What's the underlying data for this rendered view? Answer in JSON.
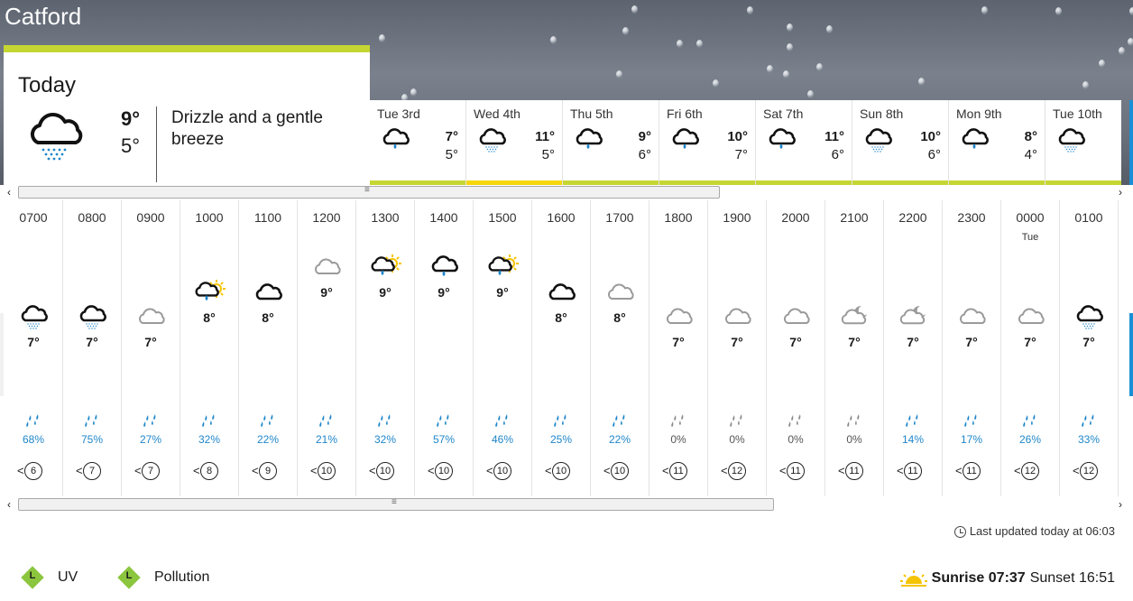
{
  "location": "Catford",
  "today": {
    "label": "Today",
    "high": "9°",
    "low": "5°",
    "description": "Drizzle and a gentle breeze",
    "icon": "cloud-drizzle-icon"
  },
  "days": [
    {
      "dow": "Tue",
      "date": "3rd",
      "high": "7°",
      "low": "5°",
      "icon": "cloud-rain-icon",
      "bar_color": "#c5d633"
    },
    {
      "dow": "Wed",
      "date": "4th",
      "high": "11°",
      "low": "5°",
      "icon": "cloud-drizzle-icon",
      "bar_color": "#f5d70c"
    },
    {
      "dow": "Thu",
      "date": "5th",
      "high": "9°",
      "low": "6°",
      "icon": "cloud-rain-icon",
      "bar_color": "#c5d633"
    },
    {
      "dow": "Fri",
      "date": "6th",
      "high": "10°",
      "low": "7°",
      "icon": "cloud-rain-icon",
      "bar_color": "#c5d633"
    },
    {
      "dow": "Sat",
      "date": "7th",
      "high": "11°",
      "low": "6°",
      "icon": "cloud-rain-icon",
      "bar_color": "#c5d633"
    },
    {
      "dow": "Sun",
      "date": "8th",
      "high": "10°",
      "low": "6°",
      "icon": "cloud-drizzle-icon",
      "bar_color": "#c5d633"
    },
    {
      "dow": "Mon",
      "date": "9th",
      "high": "8°",
      "low": "4°",
      "icon": "cloud-rain-icon",
      "bar_color": "#c5d633"
    },
    {
      "dow": "Tue",
      "date": "10th",
      "high": "",
      "low": "",
      "icon": "cloud-drizzle-icon",
      "bar_color": "#c5d633"
    }
  ],
  "hours": [
    {
      "time": "0700",
      "sub": "",
      "temp": "7°",
      "icon": "cloud-drizzle-icon",
      "prob": "68%",
      "wind": "6"
    },
    {
      "time": "0800",
      "sub": "",
      "temp": "7°",
      "icon": "cloud-drizzle-icon",
      "prob": "75%",
      "wind": "7"
    },
    {
      "time": "0900",
      "sub": "",
      "temp": "7°",
      "icon": "grey-cloud-icon",
      "prob": "27%",
      "wind": "7"
    },
    {
      "time": "1000",
      "sub": "",
      "temp": "8°",
      "icon": "sun-cloud-rain-icon",
      "prob": "32%",
      "wind": "8"
    },
    {
      "time": "1100",
      "sub": "",
      "temp": "8°",
      "icon": "black-cloud-icon",
      "prob": "22%",
      "wind": "9"
    },
    {
      "time": "1200",
      "sub": "",
      "temp": "9°",
      "icon": "grey-cloud-icon",
      "prob": "21%",
      "wind": "10"
    },
    {
      "time": "1300",
      "sub": "",
      "temp": "9°",
      "icon": "sun-cloud-rain-icon",
      "prob": "32%",
      "wind": "10"
    },
    {
      "time": "1400",
      "sub": "",
      "temp": "9°",
      "icon": "cloud-rain-icon",
      "prob": "57%",
      "wind": "10"
    },
    {
      "time": "1500",
      "sub": "",
      "temp": "9°",
      "icon": "sun-cloud-rain-icon",
      "prob": "46%",
      "wind": "10"
    },
    {
      "time": "1600",
      "sub": "",
      "temp": "8°",
      "icon": "black-cloud-icon",
      "prob": "25%",
      "wind": "10"
    },
    {
      "time": "1700",
      "sub": "",
      "temp": "8°",
      "icon": "grey-cloud-icon",
      "prob": "22%",
      "wind": "10"
    },
    {
      "time": "1800",
      "sub": "",
      "temp": "7°",
      "icon": "grey-cloud-icon",
      "prob": "0%",
      "wind": "11"
    },
    {
      "time": "1900",
      "sub": "",
      "temp": "7°",
      "icon": "grey-cloud-icon",
      "prob": "0%",
      "wind": "12"
    },
    {
      "time": "2000",
      "sub": "",
      "temp": "7°",
      "icon": "grey-cloud-icon",
      "prob": "0%",
      "wind": "11"
    },
    {
      "time": "2100",
      "sub": "",
      "temp": "7°",
      "icon": "moon-cloud-icon",
      "prob": "0%",
      "wind": "11"
    },
    {
      "time": "2200",
      "sub": "",
      "temp": "7°",
      "icon": "moon-cloud-icon",
      "prob": "14%",
      "wind": "11"
    },
    {
      "time": "2300",
      "sub": "",
      "temp": "7°",
      "icon": "grey-cloud-icon",
      "prob": "17%",
      "wind": "11"
    },
    {
      "time": "0000",
      "sub": "Tue",
      "temp": "7°",
      "icon": "grey-cloud-icon",
      "prob": "26%",
      "wind": "12"
    },
    {
      "time": "0100",
      "sub": "",
      "temp": "7°",
      "icon": "cloud-drizzle-icon",
      "prob": "33%",
      "wind": "12"
    }
  ],
  "updated": "Last updated today at 06:03",
  "legend": [
    {
      "badge": "L",
      "label": "UV",
      "color": "#8cc63f"
    },
    {
      "badge": "L",
      "label": "Pollution",
      "color": "#8cc63f"
    }
  ],
  "sunrise": "Sunrise 07:37",
  "sunset": "Sunset 16:51",
  "colors": {
    "accent": "#c5d633",
    "rain_blue": "#1f86c9",
    "sun_yellow": "#f5c400"
  }
}
